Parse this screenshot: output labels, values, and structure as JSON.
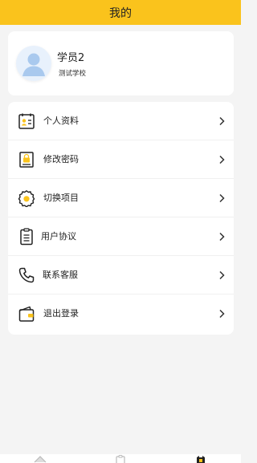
{
  "header": {
    "title": "我的"
  },
  "profile": {
    "name": "学员2",
    "school": "测试学校"
  },
  "menu": [
    {
      "label": "个人资料",
      "icon": "profile-card-icon"
    },
    {
      "label": "修改密码",
      "icon": "password-lock-icon"
    },
    {
      "label": "切换项目",
      "icon": "gear-icon"
    },
    {
      "label": "用户协议",
      "icon": "agreement-document-icon"
    },
    {
      "label": "联系客服",
      "icon": "phone-icon"
    },
    {
      "label": "退出登录",
      "icon": "wallet-logout-icon"
    }
  ],
  "tabbar": {
    "tabs": [
      {
        "icon": "home-icon"
      },
      {
        "icon": "clipboard-icon"
      },
      {
        "icon": "profile-tab-icon",
        "active": true
      }
    ]
  },
  "colors": {
    "accent": "#fac31c",
    "background": "#f4f4f4",
    "card": "#ffffff"
  }
}
